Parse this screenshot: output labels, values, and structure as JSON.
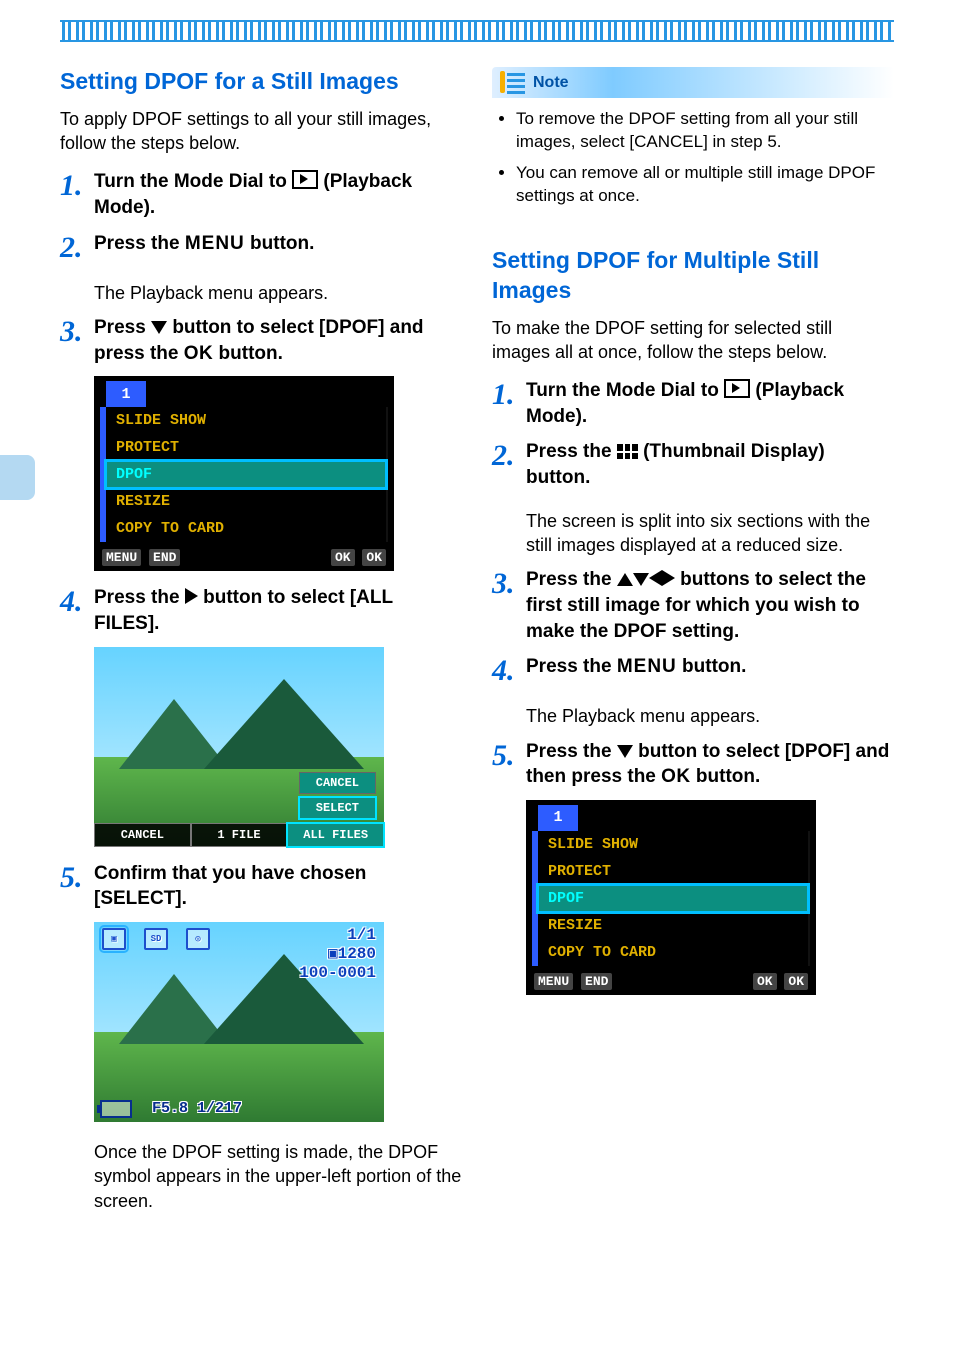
{
  "left": {
    "title": "Setting DPOF for a Still Images",
    "intro": "To apply DPOF settings to all your still images, follow the steps below.",
    "step1": {
      "pre": "Turn the Mode Dial to ",
      "post": " (Playback Mode)."
    },
    "step2": {
      "pre": "Press the ",
      "menu": "MENU",
      "post": " button.",
      "desc": "The Playback menu appears."
    },
    "step3": {
      "pre": "Press ",
      "mid": " button to select [DPOF] and press the ",
      "ok": "OK",
      "post": " button."
    },
    "step4": {
      "pre": "Press the ",
      "post": " button to select [ALL FILES]."
    },
    "step5": {
      "text": "Confirm that you have chosen [SELECT].",
      "desc": "Once the DPOF setting is made, the DPOF symbol appears in the upper-left portion of the screen."
    }
  },
  "cam1": {
    "tab": "1",
    "items": [
      "SLIDE SHOW",
      "PROTECT",
      "DPOF",
      "RESIZE",
      "COPY TO CARD"
    ],
    "selected": 2,
    "footer_left_a": "MENU",
    "footer_left_b": "END",
    "footer_right_a": "OK",
    "footer_right_b": "OK"
  },
  "cam2": {
    "popup": [
      "CANCEL",
      "SELECT"
    ],
    "popup_selected": 1,
    "opts": [
      "CANCEL",
      "1 FILE",
      "ALL FILES"
    ],
    "opts_selected": 2
  },
  "cam3": {
    "top_labels": [
      "",
      "SD",
      ""
    ],
    "frame": "1/1",
    "size": "1280",
    "fileno": "100-0001",
    "exposure": "F5.8 1/217"
  },
  "note": {
    "title": "Note",
    "items": [
      "To remove the DPOF setting from all your still images, select [CANCEL] in step 5.",
      "You can remove all or multiple still image DPOF settings at once."
    ]
  },
  "right": {
    "title": "Setting DPOF for Multiple Still Images",
    "intro": "To make the DPOF setting for selected still images all at once, follow the steps below.",
    "step1": {
      "pre": "Turn the Mode Dial to ",
      "post": " (Playback Mode)."
    },
    "step2": {
      "pre": "Press the ",
      "post": " (Thumbnail Display) button.",
      "desc": "The screen is split into six sections with the still images displayed at a reduced size."
    },
    "step3": {
      "pre": "Press the ",
      "post": " buttons to select the first still image for which you wish to make the DPOF setting."
    },
    "step4": {
      "pre": "Press the ",
      "menu": "MENU",
      "post": " button.",
      "desc": "The Playback menu appears."
    },
    "step5": {
      "pre": "Press the ",
      "mid": " button to select [DPOF] and then press the ",
      "ok": "OK",
      "post": " button."
    }
  },
  "cam4": {
    "tab": "1",
    "items": [
      "SLIDE SHOW",
      "PROTECT",
      "DPOF",
      "RESIZE",
      "COPY TO CARD"
    ],
    "selected": 2,
    "footer_left_a": "MENU",
    "footer_left_b": "END",
    "footer_right_a": "OK",
    "footer_right_b": "OK"
  }
}
